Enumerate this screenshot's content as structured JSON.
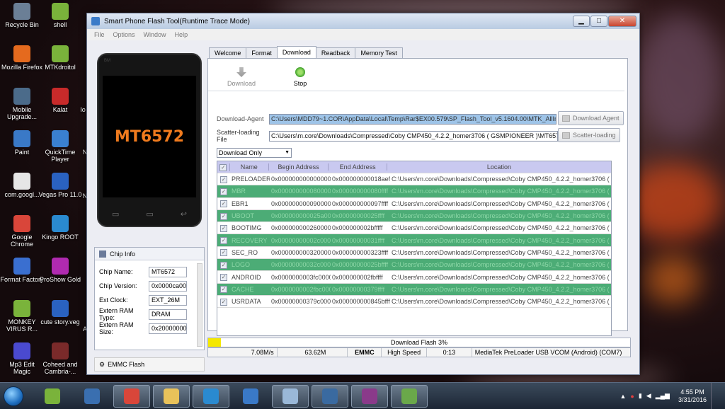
{
  "desktop": {
    "icons": [
      {
        "label": "Recycle Bin",
        "icon": "recycle-bin-icon",
        "color": "#6b7f96"
      },
      {
        "label": "shell",
        "icon": "android-icon",
        "color": "#7ab33b"
      },
      {
        "label": "Mozilla Firefox",
        "icon": "firefox-icon",
        "color": "#e56a1e"
      },
      {
        "label": "MTKdroitol",
        "icon": "android-icon",
        "color": "#7ab33b"
      },
      {
        "label": "Mobile Upgrade...",
        "icon": "gear-icon",
        "color": "#4b6b8a"
      },
      {
        "label": "Kalat",
        "icon": "x-icon",
        "color": "#c82a2a"
      },
      {
        "label": "Paint",
        "icon": "paint-icon",
        "color": "#3a79c7"
      },
      {
        "label": "QuickTime Player",
        "icon": "quicktime-icon",
        "color": "#3a80d0"
      },
      {
        "label": "com.googl...",
        "icon": "file-icon",
        "color": "#e6e6e6"
      },
      {
        "label": "Vegas Pro 11.0",
        "icon": "vegas-icon",
        "color": "#2a62c0"
      },
      {
        "label": "Google Chrome",
        "icon": "chrome-icon",
        "color": "#d9463a"
      },
      {
        "label": "Kingo ROOT",
        "icon": "kingo-icon",
        "color": "#2a8ad0"
      },
      {
        "label": "Format Factory",
        "icon": "format-factory-icon",
        "color": "#3a6fd0"
      },
      {
        "label": "ProShow Gold",
        "icon": "proshow-icon",
        "color": "#b02ab0"
      },
      {
        "label": "MONKEY VIRUS R...",
        "icon": "android-icon",
        "color": "#7ab33b"
      },
      {
        "label": "cute story.veg",
        "icon": "vegas-icon",
        "color": "#2a62c0"
      },
      {
        "label": "Mp3 Edit Magic",
        "icon": "mp3-icon",
        "color": "#4a4ad0"
      },
      {
        "label": "Coheed and Cambria-...",
        "icon": "music-icon",
        "color": "#7a2a2a"
      }
    ],
    "partial_labels": [
      "Io",
      "N",
      "N",
      "A"
    ]
  },
  "window": {
    "title": "Smart Phone Flash Tool(Runtime Trace Mode)",
    "controls": {
      "minimize": "▁",
      "maximize": "□",
      "close": "✕"
    },
    "menu": [
      "File",
      "Options",
      "Window",
      "Help"
    ]
  },
  "phone": {
    "brand": "BM",
    "chip": "MT6572"
  },
  "chip_info": {
    "title": "Chip Info",
    "rows": [
      {
        "label": "Chip Name:",
        "value": "MT6572"
      },
      {
        "label": "Chip Version:",
        "value": "0x0000ca00"
      },
      {
        "label": "Ext Clock:",
        "value": "EXT_26M"
      },
      {
        "label": "Extern RAM Type:",
        "value": "DRAM"
      },
      {
        "label": "Extern RAM Size:",
        "value": "0x20000000"
      }
    ]
  },
  "emmc_label": "EMMC Flash",
  "tabs": [
    {
      "label": "Welcome",
      "active": false
    },
    {
      "label": "Format",
      "active": false
    },
    {
      "label": "Download",
      "active": true
    },
    {
      "label": "Readback",
      "active": false
    },
    {
      "label": "Memory Test",
      "active": false
    }
  ],
  "toolbar": {
    "download_label": "Download",
    "stop_label": "Stop"
  },
  "download_agent": {
    "label": "Download-Agent",
    "value": "C:\\Users\\MDD79~1.COR\\AppData\\Local\\Temp\\Rar$EX00.579\\SP_Flash_Tool_v5.1604.00\\MTK_AllInOne_DA.bin",
    "button": "Download Agent"
  },
  "scatter": {
    "label": "Scatter-loading File",
    "value": "C:\\Users\\m.core\\Downloads\\Compressed\\Coby CMP450_4.2.2_homer3706 ( GSMPIONEER )\\MT6572-2016-0",
    "button": "Scatter-loading"
  },
  "mode": "Download Only",
  "table": {
    "headers": [
      "Name",
      "Begin Address",
      "End Address",
      "Location"
    ],
    "rows": [
      {
        "name": "PRELOADER",
        "begin": "0x0000000000000000",
        "end": "0x000000000018aef",
        "loc": "C:\\Users\\m.core\\Downloads\\Compressed\\Coby CMP450_4.2.2_homer3706 (",
        "green": false
      },
      {
        "name": "MBR",
        "begin": "0x0000000000800000",
        "end": "0x000000000080ffff",
        "loc": "C:\\Users\\m.core\\Downloads\\Compressed\\Coby CMP450_4.2.2_homer3706 (",
        "green": true
      },
      {
        "name": "EBR1",
        "begin": "0x0000000000900000",
        "end": "0x000000000097ffff",
        "loc": "C:\\Users\\m.core\\Downloads\\Compressed\\Coby CMP450_4.2.2_homer3706 (",
        "green": false
      },
      {
        "name": "UBOOT",
        "begin": "0x000000000025a0000",
        "end": "0x00000000025ffff",
        "loc": "C:\\Users\\m.core\\Downloads\\Compressed\\Coby CMP450_4.2.2_homer3706 (",
        "green": true
      },
      {
        "name": "BOOTIMG",
        "begin": "0x0000000002600000",
        "end": "0x000000002bfffff",
        "loc": "C:\\Users\\m.core\\Downloads\\Compressed\\Coby CMP450_4.2.2_homer3706 (",
        "green": false
      },
      {
        "name": "RECOVERY",
        "begin": "0x00000000002c00000",
        "end": "0x00000000031ffff",
        "loc": "C:\\Users\\m.core\\Downloads\\Compressed\\Coby CMP450_4.2.2_homer3706 (",
        "green": true
      },
      {
        "name": "SEC_RO",
        "begin": "0x0000000003200000",
        "end": "0x000000000323ffff",
        "loc": "C:\\Users\\m.core\\Downloads\\Compressed\\Coby CMP450_4.2.2_homer3706 (",
        "green": false
      },
      {
        "name": "LOGO",
        "begin": "0x00000000032c0000",
        "end": "0x00000000025bffff",
        "loc": "C:\\Users\\m.core\\Downloads\\Compressed\\Coby CMP450_4.2.2_homer3706 (",
        "green": true
      },
      {
        "name": "ANDROID",
        "begin": "0x0000000003fc0000",
        "end": "0x000000002fbffff",
        "loc": "C:\\Users\\m.core\\Downloads\\Compressed\\Coby CMP450_4.2.2_homer3706 (",
        "green": false
      },
      {
        "name": "CACHE",
        "begin": "0x0000000002fbc0000",
        "end": "0x00000000379ffff",
        "loc": "C:\\Users\\m.core\\Downloads\\Compressed\\Coby CMP450_4.2.2_homer3706 (",
        "green": true
      },
      {
        "name": "USRDATA",
        "begin": "0x00000000379c0000",
        "end": "0x000000000845bffff",
        "loc": "C:\\Users\\m.core\\Downloads\\Compressed\\Coby CMP450_4.2.2_homer3706 (",
        "green": false
      }
    ]
  },
  "progress": {
    "text": "Download Flash 3%",
    "percent": 3,
    "color": "#f4e800"
  },
  "status": {
    "speed": "7.08M/s",
    "size": "63.62M",
    "storage": "EMMC",
    "mode": "High Speed",
    "time": "0:13",
    "port": "MediaTek PreLoader USB VCOM (Android) (COM7)"
  },
  "taskbar": {
    "apps": [
      {
        "icon": "android-icon",
        "color": "#7ab33b",
        "active": false
      },
      {
        "icon": "windows-defender-icon",
        "color": "#3a6fb0",
        "active": false
      },
      {
        "icon": "chrome-icon",
        "color": "#d9463a",
        "active": true
      },
      {
        "icon": "folder-icon",
        "color": "#e8c25a",
        "active": true
      },
      {
        "icon": "kingo-icon",
        "color": "#2a8ad0",
        "active": true
      },
      {
        "icon": "paint-icon",
        "color": "#3a79c7",
        "active": false
      },
      {
        "icon": "notepad-icon",
        "color": "#9ab8d8",
        "active": true
      },
      {
        "icon": "remote-icon",
        "color": "#3a6aa0",
        "active": true
      },
      {
        "icon": "winrar-icon",
        "color": "#8a3a8a",
        "active": true
      },
      {
        "icon": "flash-tool-icon",
        "color": "#6aa84a",
        "active": true
      }
    ],
    "time": "4:55 PM",
    "date": "3/31/2016"
  }
}
